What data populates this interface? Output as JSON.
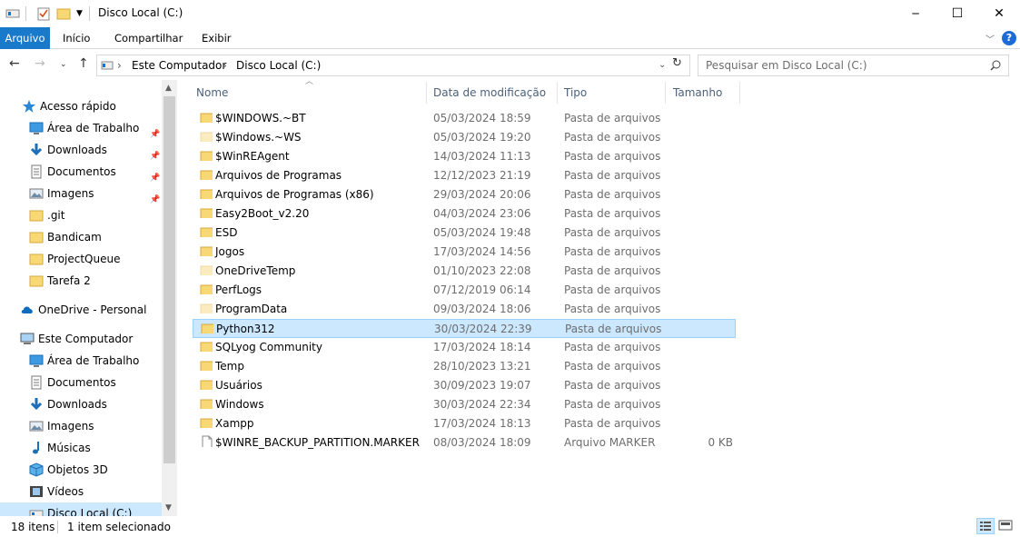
{
  "window": {
    "title": "Disco Local (C:)",
    "minimize": "─",
    "maximize": "☐",
    "close": "✕"
  },
  "ribbon": {
    "tabs": [
      "Arquivo",
      "Início",
      "Compartilhar",
      "Exibir"
    ],
    "help": "?"
  },
  "address": {
    "crumbs": [
      "Este Computador",
      "Disco Local (C:)"
    ],
    "search_placeholder": "Pesquisar em Disco Local (C:)"
  },
  "nav": {
    "quick_access": "Acesso rápido",
    "quick_items": [
      {
        "label": "Área de Trabalho",
        "icon": "desktop-icon",
        "pinned": true
      },
      {
        "label": "Downloads",
        "icon": "download-icon",
        "pinned": true
      },
      {
        "label": "Documentos",
        "icon": "document-icon",
        "pinned": true
      },
      {
        "label": "Imagens",
        "icon": "image-icon",
        "pinned": true
      },
      {
        "label": ".git",
        "icon": "folder-icon",
        "pinned": false
      },
      {
        "label": "Bandicam",
        "icon": "folder-icon",
        "pinned": false
      },
      {
        "label": "ProjectQueue",
        "icon": "folder-icon",
        "pinned": false
      },
      {
        "label": "Tarefa 2",
        "icon": "folder-icon",
        "pinned": false
      }
    ],
    "onedrive": "OneDrive - Personal",
    "this_pc": "Este Computador",
    "pc_items": [
      {
        "label": "Área de Trabalho",
        "icon": "desktop-icon"
      },
      {
        "label": "Documentos",
        "icon": "document-icon"
      },
      {
        "label": "Downloads",
        "icon": "download-icon"
      },
      {
        "label": "Imagens",
        "icon": "image-icon"
      },
      {
        "label": "Músicas",
        "icon": "music-icon"
      },
      {
        "label": "Objetos 3D",
        "icon": "cube-icon"
      },
      {
        "label": "Vídeos",
        "icon": "video-icon"
      },
      {
        "label": "Disco Local (C:)",
        "icon": "drive-icon"
      }
    ]
  },
  "columns": {
    "name": "Nome",
    "date": "Data de modificação",
    "type": "Tipo",
    "size": "Tamanho"
  },
  "files": [
    {
      "name": "$WINDOWS.~BT",
      "date": "05/03/2024 18:59",
      "type": "Pasta de arquivos",
      "size": "",
      "icon": "folder-icon",
      "faded": false
    },
    {
      "name": "$Windows.~WS",
      "date": "05/03/2024 19:20",
      "type": "Pasta de arquivos",
      "size": "",
      "icon": "folder-icon",
      "faded": true
    },
    {
      "name": "$WinREAgent",
      "date": "14/03/2024 11:13",
      "type": "Pasta de arquivos",
      "size": "",
      "icon": "folder-icon",
      "faded": false
    },
    {
      "name": "Arquivos de Programas",
      "date": "12/12/2023 21:19",
      "type": "Pasta de arquivos",
      "size": "",
      "icon": "folder-icon",
      "faded": false
    },
    {
      "name": "Arquivos de Programas (x86)",
      "date": "29/03/2024 20:06",
      "type": "Pasta de arquivos",
      "size": "",
      "icon": "folder-icon",
      "faded": false
    },
    {
      "name": "Easy2Boot_v2.20",
      "date": "04/03/2024 23:06",
      "type": "Pasta de arquivos",
      "size": "",
      "icon": "folder-icon",
      "faded": false
    },
    {
      "name": "ESD",
      "date": "05/03/2024 19:48",
      "type": "Pasta de arquivos",
      "size": "",
      "icon": "folder-icon",
      "faded": false
    },
    {
      "name": "Jogos",
      "date": "17/03/2024 14:56",
      "type": "Pasta de arquivos",
      "size": "",
      "icon": "folder-icon",
      "faded": false
    },
    {
      "name": "OneDriveTemp",
      "date": "01/10/2023 22:08",
      "type": "Pasta de arquivos",
      "size": "",
      "icon": "folder-icon",
      "faded": true
    },
    {
      "name": "PerfLogs",
      "date": "07/12/2019 06:14",
      "type": "Pasta de arquivos",
      "size": "",
      "icon": "folder-icon",
      "faded": false
    },
    {
      "name": "ProgramData",
      "date": "09/03/2024 18:06",
      "type": "Pasta de arquivos",
      "size": "",
      "icon": "folder-icon",
      "faded": true
    },
    {
      "name": "Python312",
      "date": "30/03/2024 22:39",
      "type": "Pasta de arquivos",
      "size": "",
      "icon": "folder-icon",
      "faded": false,
      "selected": true
    },
    {
      "name": "SQLyog Community",
      "date": "17/03/2024 18:14",
      "type": "Pasta de arquivos",
      "size": "",
      "icon": "folder-icon",
      "faded": false
    },
    {
      "name": "Temp",
      "date": "28/10/2023 13:21",
      "type": "Pasta de arquivos",
      "size": "",
      "icon": "folder-icon",
      "faded": false
    },
    {
      "name": "Usuários",
      "date": "30/09/2023 19:07",
      "type": "Pasta de arquivos",
      "size": "",
      "icon": "folder-icon",
      "faded": false
    },
    {
      "name": "Windows",
      "date": "30/03/2024 22:34",
      "type": "Pasta de arquivos",
      "size": "",
      "icon": "folder-icon",
      "faded": false
    },
    {
      "name": "Xampp",
      "date": "17/03/2024 18:13",
      "type": "Pasta de arquivos",
      "size": "",
      "icon": "folder-icon",
      "faded": false
    },
    {
      "name": "$WINRE_BACKUP_PARTITION.MARKER",
      "date": "08/03/2024 18:09",
      "type": "Arquivo MARKER",
      "size": "0 KB",
      "icon": "file-icon",
      "faded": false
    }
  ],
  "status": {
    "count": "18 itens",
    "selection": "1 item selecionado"
  },
  "colors": {
    "accent": "#1979ca",
    "selection_bg": "#cce8ff",
    "selection_border": "#99d1ff",
    "folder": "#f8d775"
  }
}
